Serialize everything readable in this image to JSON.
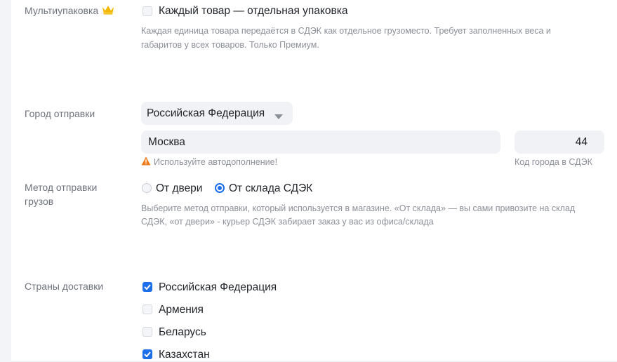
{
  "multipack": {
    "label": "Мультиупаковка",
    "premium_icon": "crown-icon",
    "option_label": "Каждый товар — отдельная упаковка",
    "checked": false,
    "hint_line1": "Каждая единица товара передаётся в СДЭК как отдельное грузоместо. Требует заполненных веса и",
    "hint_line2": "габаритов у всех товаров. Только Премиум."
  },
  "origin_city": {
    "label": "Город отправки",
    "country_select": "Российская Федерация",
    "city_value": "Москва",
    "city_warning": "Используйте автодополнение!",
    "code_value": "44",
    "code_caption": "Код города в СДЭК"
  },
  "ship_method": {
    "label_line1": "Метод отправки",
    "label_line2": "грузов",
    "options": [
      {
        "label": "От двери",
        "selected": false
      },
      {
        "label": "От склада СДЭК",
        "selected": true
      }
    ],
    "hint_line1": "Выберите метод отправки, который используется в магазине. «От склада» — вы сами привозите на склад",
    "hint_line2": "СДЭК, «от двери» - курьер СДЭК забирает заказ у вас из офиса/склада"
  },
  "countries": {
    "label": "Страны доставки",
    "items": [
      {
        "label": "Российская Федерация",
        "checked": true
      },
      {
        "label": "Армения",
        "checked": false
      },
      {
        "label": "Беларусь",
        "checked": false
      },
      {
        "label": "Казахстан",
        "checked": true
      }
    ]
  },
  "colors": {
    "accent": "#1d6ee9",
    "crown": "#f5b800",
    "warning": "#f07c1e"
  }
}
